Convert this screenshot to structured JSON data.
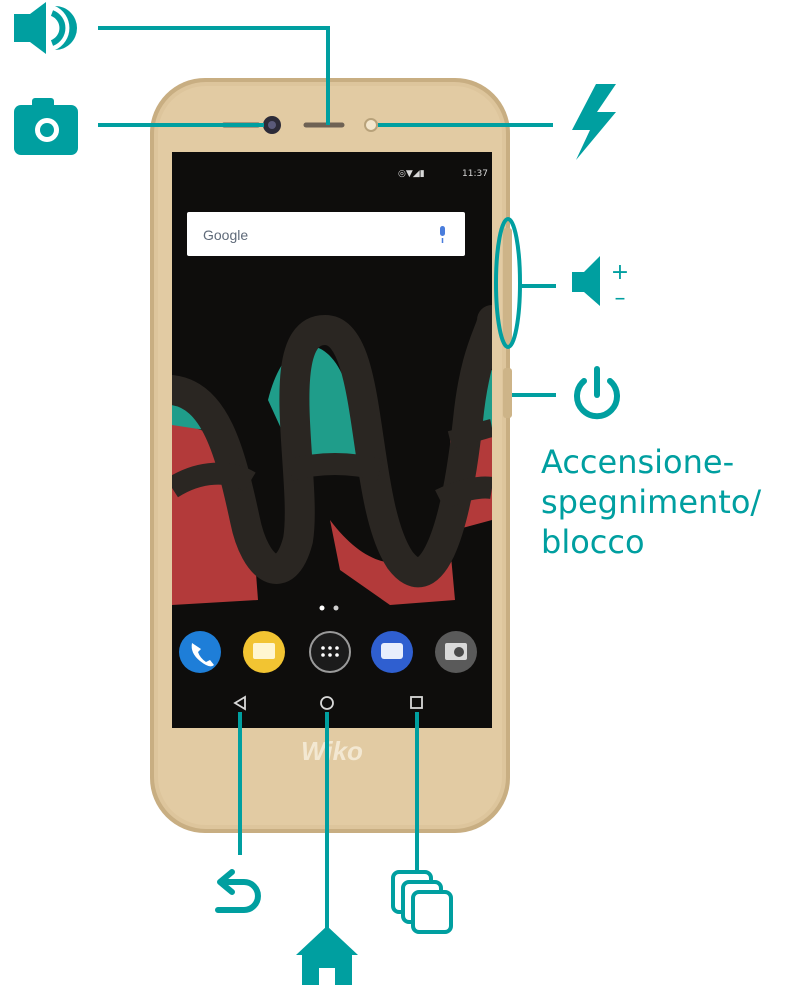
{
  "colors": {
    "accent": "#009fa0",
    "phone_body": "#dcc49b",
    "screen": "#0e0d0c"
  },
  "screen": {
    "status_time": "11:37",
    "search_text": "Google",
    "home_page_dots": 2
  },
  "phone": {
    "brand_logo": "Wiko"
  },
  "callouts": {
    "power_label": [
      "Accensione-",
      "spegnimento/",
      "blocco"
    ],
    "volume_plus": "+",
    "volume_minus": "–"
  },
  "icons": [
    "speaker-icon",
    "camera-icon",
    "flash-icon",
    "volume-rocker-icon",
    "power-icon",
    "back-icon",
    "home-icon",
    "recent-apps-icon",
    "phone-app-icon",
    "messages-app-icon",
    "app-drawer-icon",
    "chat-app-icon",
    "camera-app-icon",
    "microphone-icon"
  ]
}
